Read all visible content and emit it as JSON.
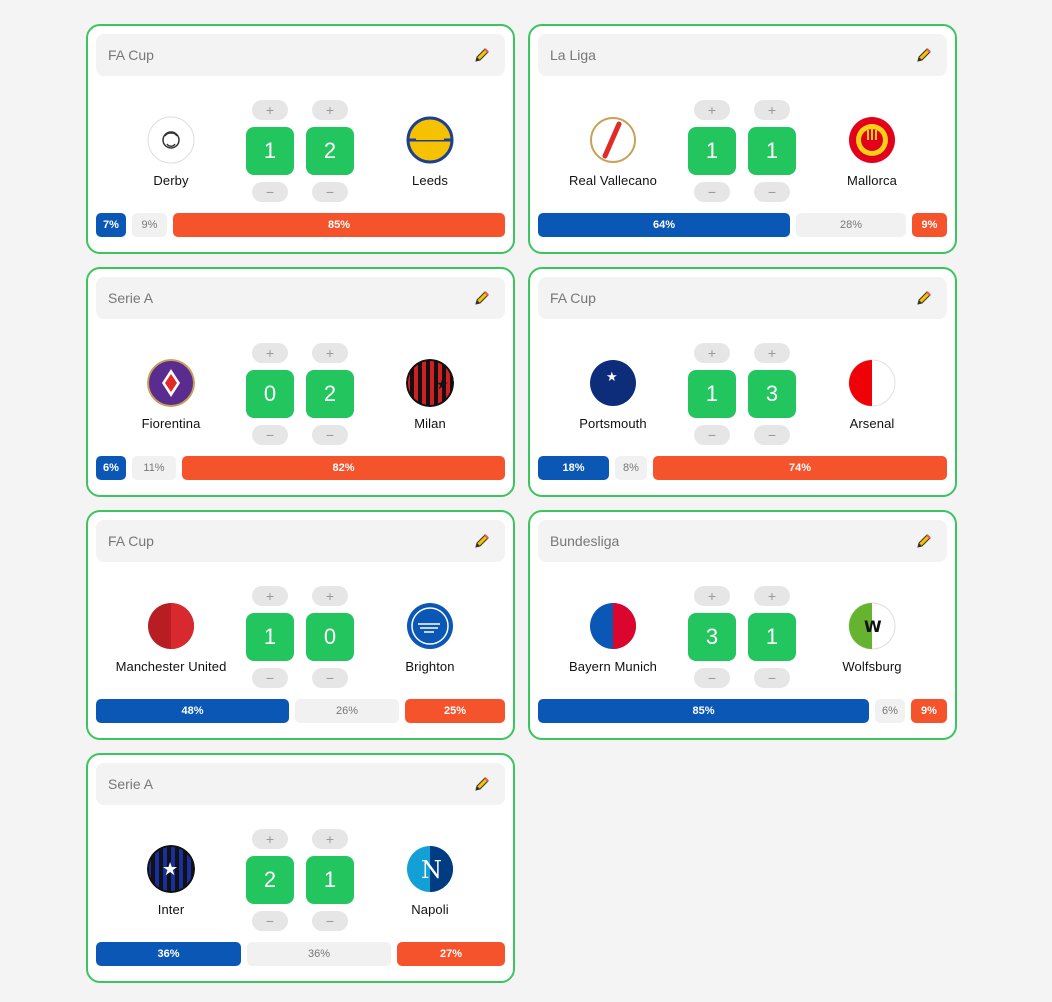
{
  "colors": {
    "border": "#3cc45f",
    "score_bg": "#22c55e",
    "home_bar": "#0b57b5",
    "draw_bar": "#f1f1f1",
    "away_bar": "#f4532b"
  },
  "controls": {
    "plus": "+",
    "minus": "−",
    "edit_icon": "pencil-icon"
  },
  "matches": [
    {
      "league": "FA Cup",
      "home": {
        "name": "Derby",
        "logo": "derby-ram-badge"
      },
      "away": {
        "name": "Leeds",
        "logo": "leeds-badge"
      },
      "home_score": "1",
      "away_score": "2",
      "prob": {
        "home": "7%",
        "draw": "9%",
        "away": "85%"
      }
    },
    {
      "league": "La Liga",
      "home": {
        "name": "Real Vallecano",
        "logo": "vallecano-sash-badge"
      },
      "away": {
        "name": "Mallorca",
        "logo": "mallorca-badge"
      },
      "home_score": "1",
      "away_score": "1",
      "prob": {
        "home": "64%",
        "draw": "28%",
        "away": "9%"
      }
    },
    {
      "league": "Serie A",
      "home": {
        "name": "Fiorentina",
        "logo": "fiorentina-lily-badge"
      },
      "away": {
        "name": "Milan",
        "logo": "milan-stripes-badge"
      },
      "home_score": "0",
      "away_score": "2",
      "prob": {
        "home": "6%",
        "draw": "11%",
        "away": "82%"
      }
    },
    {
      "league": "FA Cup",
      "home": {
        "name": "Portsmouth",
        "logo": "portsmouth-star-moon-badge"
      },
      "away": {
        "name": "Arsenal",
        "logo": "arsenal-halves-badge"
      },
      "home_score": "1",
      "away_score": "3",
      "prob": {
        "home": "18%",
        "draw": "8%",
        "away": "74%"
      }
    },
    {
      "league": "FA Cup",
      "home": {
        "name": "Manchester United",
        "logo": "manutd-red-badge"
      },
      "away": {
        "name": "Brighton",
        "logo": "brighton-badge"
      },
      "home_score": "1",
      "away_score": "0",
      "prob": {
        "home": "48%",
        "draw": "26%",
        "away": "25%"
      }
    },
    {
      "league": "Bundesliga",
      "home": {
        "name": "Bayern Munich",
        "logo": "bayern-halves-badge"
      },
      "away": {
        "name": "Wolfsburg",
        "logo": "wolfsburg-w-badge"
      },
      "home_score": "3",
      "away_score": "1",
      "prob": {
        "home": "85%",
        "draw": "6%",
        "away": "9%"
      }
    },
    {
      "league": "Serie A",
      "home": {
        "name": "Inter",
        "logo": "inter-star-stripes-badge"
      },
      "away": {
        "name": "Napoli",
        "logo": "napoli-n-badge"
      },
      "home_score": "2",
      "away_score": "1",
      "prob": {
        "home": "36%",
        "draw": "36%",
        "away": "27%"
      }
    }
  ]
}
